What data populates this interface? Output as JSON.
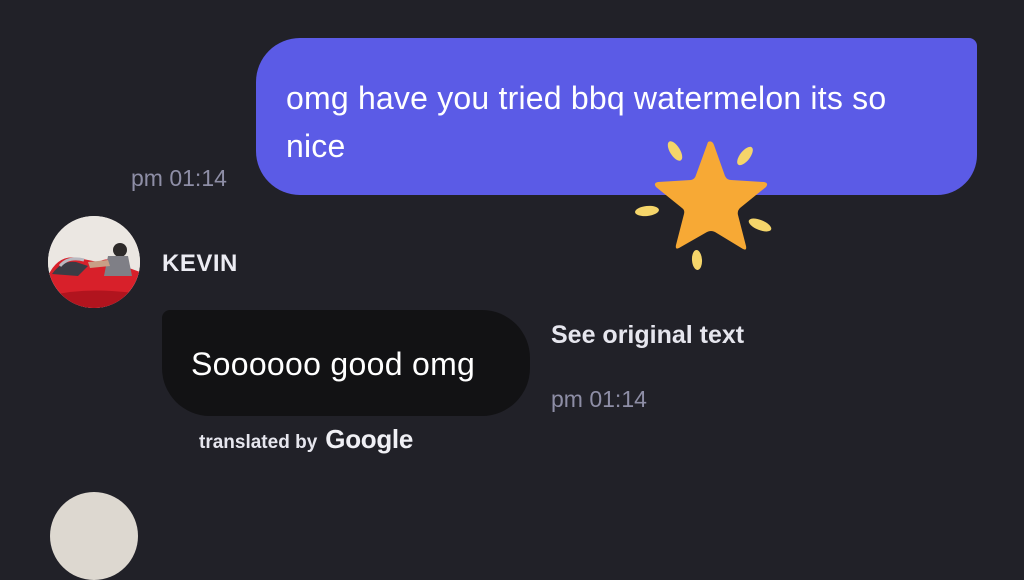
{
  "messages": {
    "outgoing": {
      "text": "omg have you tried bbq watermelon its so nice",
      "time": "pm 01:14",
      "bubble_color": "#5b5be6",
      "sticker": "star-sticker"
    },
    "incoming": {
      "sender": "KEVIN",
      "text": "Soooooo good omg",
      "time": "pm 01:14",
      "see_original_label": "See original text",
      "translated_by_label": "translated by",
      "translator_logo": "Google",
      "bubble_color": "#121214"
    }
  },
  "theme": {
    "background": "#212128",
    "timestamp_color": "#8e8ea6",
    "star_color": "#f7a935",
    "sparkle_color": "#f5d56a"
  }
}
